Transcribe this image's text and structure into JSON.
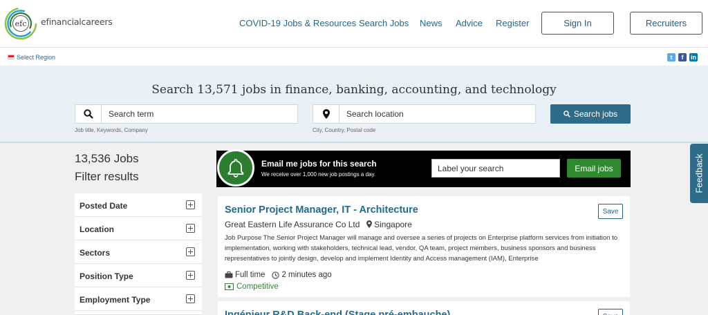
{
  "header": {
    "logo_mark": "efc",
    "logo_text": "efinancialcareers",
    "nav": [
      {
        "label": "COVID-19 Jobs & Resources"
      },
      {
        "label": "Search Jobs"
      },
      {
        "label": "News"
      },
      {
        "label": "Advice"
      },
      {
        "label": "Register"
      }
    ],
    "sign_in": "Sign In",
    "recruiters": "Recruiters"
  },
  "region": {
    "label": "Select Region"
  },
  "social": [
    "twitter-icon",
    "facebook-icon",
    "linkedin-icon"
  ],
  "search": {
    "title": "Search 13,571 jobs in finance, banking, accounting, and technology",
    "term_placeholder": "Search term",
    "term_hint": "Job title, Keywords, Company",
    "location_placeholder": "Search location",
    "location_hint": "City, Country, Postal code",
    "button": "Search jobs"
  },
  "sidebar": {
    "job_count": "13,536 Jobs",
    "filter_title": "Filter results",
    "filters": [
      {
        "label": "Posted Date"
      },
      {
        "label": "Location"
      },
      {
        "label": "Sectors"
      },
      {
        "label": "Position Type"
      },
      {
        "label": "Employment Type"
      }
    ]
  },
  "email_alert": {
    "title": "Email me jobs for this search",
    "subtitle": "We receive over 1,000 new job postings a day.",
    "input_placeholder": "Label your search",
    "button": "Email jobs"
  },
  "jobs": [
    {
      "title": "Senior Project Manager, IT - Architecture",
      "company": "Great Eastern Life Assurance Co Ltd",
      "location": "Singapore",
      "description": "Job Purpose The Senior Project Manager will manage and oversee a series of projects on Enterprise platform services from initiation to implementation, working with stakeholders, technical lead, vendor, QA team, project members, business sponsors and business representatives to jointly design, develop and implement Identity and Access management (IAM), Enterprise",
      "employment": "Full time",
      "posted": "2 minutes ago",
      "salary": "Competitive",
      "save": "Save"
    },
    {
      "title": "Ingénieur R&D Back-end (Stage pré-embauche)",
      "save": "Save"
    }
  ],
  "feedback": "Feedback",
  "colors": {
    "brand_blue": "#1f6a8e",
    "button_blue": "#2e6c8a",
    "green": "#2f8a2f",
    "search_band": "#e9f0f6"
  }
}
